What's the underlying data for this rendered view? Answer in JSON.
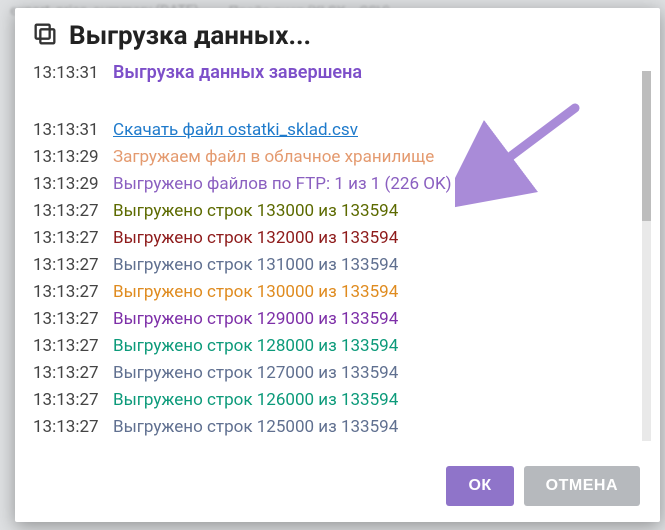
{
  "dialog": {
    "title": "Выгрузка данных...",
    "ok": "ОК",
    "cancel": "ОТМЕНА"
  },
  "log": [
    {
      "time": "13:13:31",
      "text": "Выгрузка данных завершена",
      "cls": "lead"
    },
    {
      "time": "",
      "text": "",
      "cls": "space"
    },
    {
      "time": "13:13:31",
      "text": "Скачать файл ostatki_sklad.csv",
      "cls": "link",
      "interactive": true
    },
    {
      "time": "13:13:29",
      "text": "Загружаем файл в облачное хранилище",
      "cls": "c-peach"
    },
    {
      "time": "13:13:29",
      "text": "Выгружено файлов по FTP: 1 из 1 (226 OK)",
      "cls": "c-purple"
    },
    {
      "time": "13:13:27",
      "text": "Выгружено строк 133000 из 133594",
      "cls": "c-olive"
    },
    {
      "time": "13:13:27",
      "text": "Выгружено строк 132000 из 133594",
      "cls": "c-maroon"
    },
    {
      "time": "13:13:27",
      "text": "Выгружено строк 131000 из 133594",
      "cls": "c-steel"
    },
    {
      "time": "13:13:27",
      "text": "Выгружено строк 130000 из 133594",
      "cls": "c-orange"
    },
    {
      "time": "13:13:27",
      "text": "Выгружено строк 129000 из 133594",
      "cls": "c-violet"
    },
    {
      "time": "13:13:27",
      "text": "Выгружено строк 128000 из 133594",
      "cls": "c-teal"
    },
    {
      "time": "13:13:27",
      "text": "Выгружено строк 127000 из 133594",
      "cls": "c-steel"
    },
    {
      "time": "13:13:27",
      "text": "Выгружено строк 126000 из 133594",
      "cls": "c-teal"
    },
    {
      "time": "13:13:27",
      "text": "Выгружено строк 125000 из 133594",
      "cls": "c-steel"
    }
  ]
}
